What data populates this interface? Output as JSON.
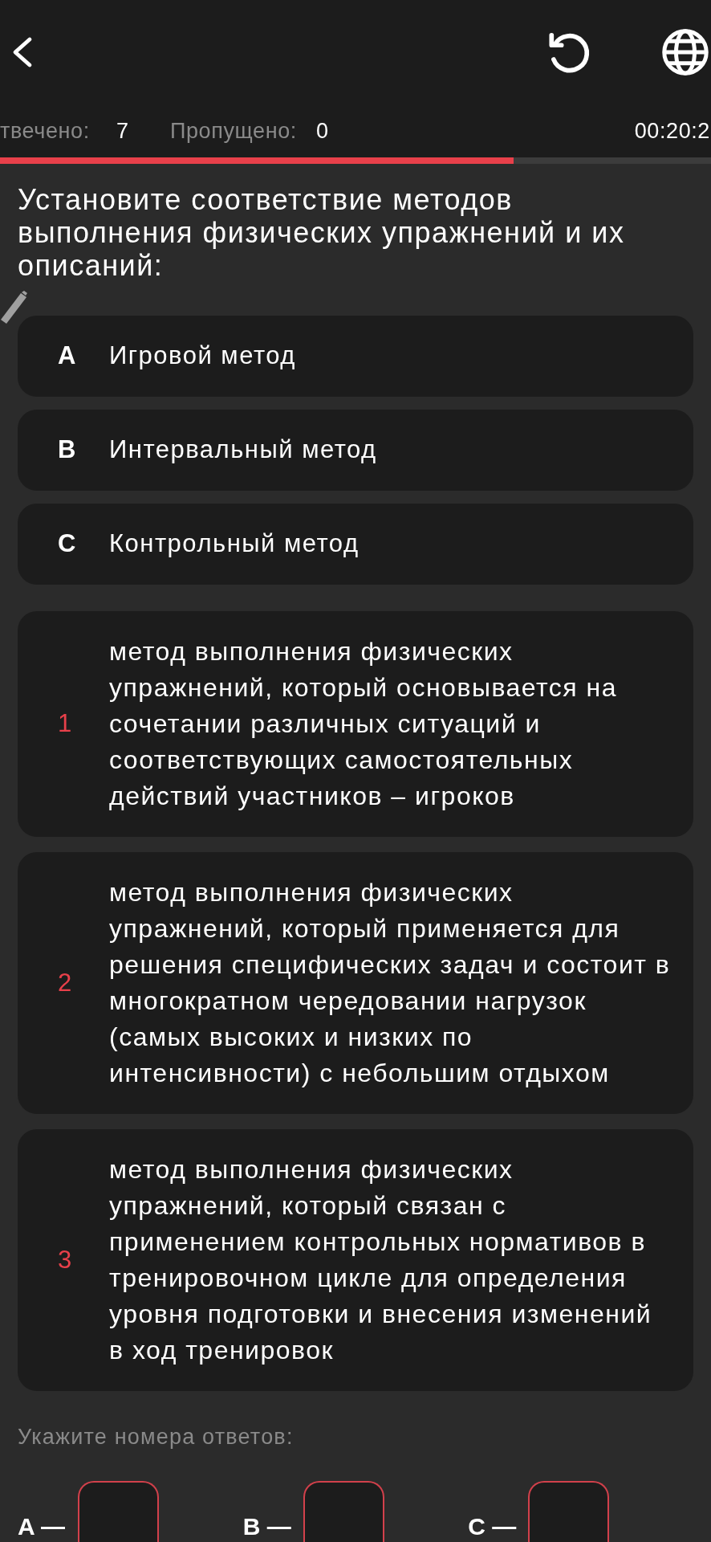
{
  "stats": {
    "answered_label": "твечено:",
    "answered": "7",
    "skipped_label": "Пропущено:",
    "skipped": "0",
    "timer": "00:20:2"
  },
  "progress": {
    "level": 0.722
  },
  "question": "Установите соответствие методов выполнения физических упражнений и их описаний:",
  "options": [
    {
      "letter": "A",
      "text": "Игровой метод"
    },
    {
      "letter": "B",
      "text": "Интервальный метод"
    },
    {
      "letter": "C",
      "text": "Контрольный метод"
    }
  ],
  "descriptions": [
    {
      "number": "1",
      "text": "метод выполнения физических упражнений, который основывается на сочетании различных ситуаций и соответствующих самостоятельных действий участников – игроков"
    },
    {
      "number": "2",
      "text": "метод выполнения физических упражнений, который применяется для решения специфических задач и состоит в многократном чередовании нагрузок (самых высоких и низких по интенсивности) с небольшим отдыхом"
    },
    {
      "number": "3",
      "text": "метод выполнения физических упражнений, который связан с применением контрольных нормативов в тренировочном цикле для определения уровня подготовки и внесения изменений в ход тренировок"
    }
  ],
  "answer_prompt": "Укажите номера ответов:",
  "answers": [
    {
      "label": "A —"
    },
    {
      "label": "B —"
    },
    {
      "label": "C —"
    }
  ]
}
